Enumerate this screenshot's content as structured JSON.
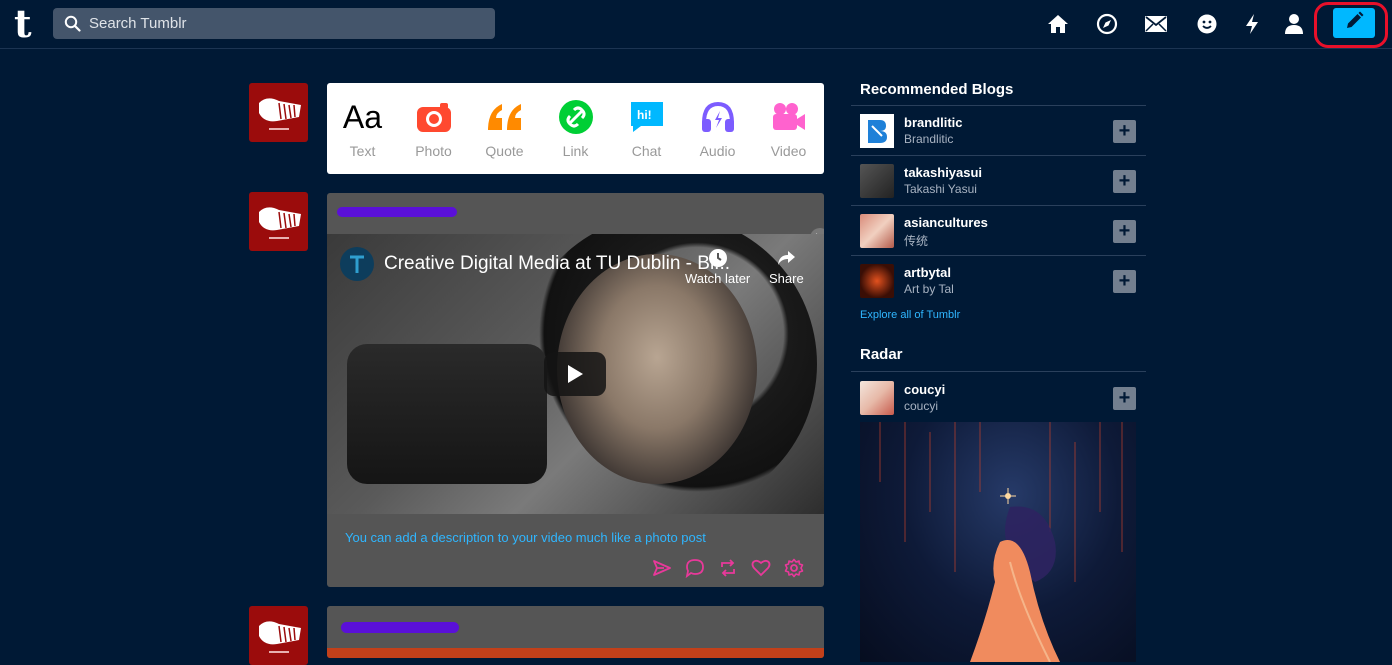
{
  "app": {
    "logo": "t"
  },
  "search": {
    "placeholder": "Search Tumblr"
  },
  "nav": {
    "icons": [
      "home-icon",
      "explore-icon",
      "mail-icon",
      "chat-face-icon",
      "activity-icon",
      "account-icon"
    ],
    "compose_icon": "pencil-icon"
  },
  "composer": {
    "types": [
      {
        "label": "Text",
        "icon": "Aa",
        "color": "#000000"
      },
      {
        "label": "Photo",
        "icon": "camera-icon",
        "color": "#ff492f"
      },
      {
        "label": "Quote",
        "icon": "quote-icon",
        "color": "#ff8a00"
      },
      {
        "label": "Link",
        "icon": "link-icon",
        "color": "#00cf35"
      },
      {
        "label": "Chat",
        "icon": "hi!",
        "color": "#00b8ff"
      },
      {
        "label": "Audio",
        "icon": "headphones-icon",
        "color": "#7c5cff"
      },
      {
        "label": "Video",
        "icon": "video-icon",
        "color": "#ff62ce"
      }
    ]
  },
  "posts": [
    {
      "video": {
        "title": "Creative Digital Media at TU Dublin - Bl...",
        "watch_later": "Watch later",
        "share": "Share"
      },
      "description": "You can add a description to your video much like a photo post",
      "actions": [
        "send-icon",
        "reply-icon",
        "reblog-icon",
        "like-icon",
        "settings-icon"
      ],
      "action_color": "#e8399a"
    }
  ],
  "sidebar": {
    "recommended_title": "Recommended Blogs",
    "blogs": [
      {
        "name": "brandlitic",
        "subtitle": "Brandlitic"
      },
      {
        "name": "takashiyasui",
        "subtitle": "Takashi Yasui"
      },
      {
        "name": "asiancultures",
        "subtitle": "传统"
      },
      {
        "name": "artbytal",
        "subtitle": "Art by Tal"
      }
    ],
    "explore_link": "Explore all of Tumblr",
    "radar_title": "Radar",
    "radar": {
      "name": "coucyi",
      "subtitle": "coucyi"
    },
    "follow_label": "+"
  },
  "colors": {
    "background": "#001935",
    "accent": "#00b8ff",
    "highlight_ring": "#e8102a"
  }
}
